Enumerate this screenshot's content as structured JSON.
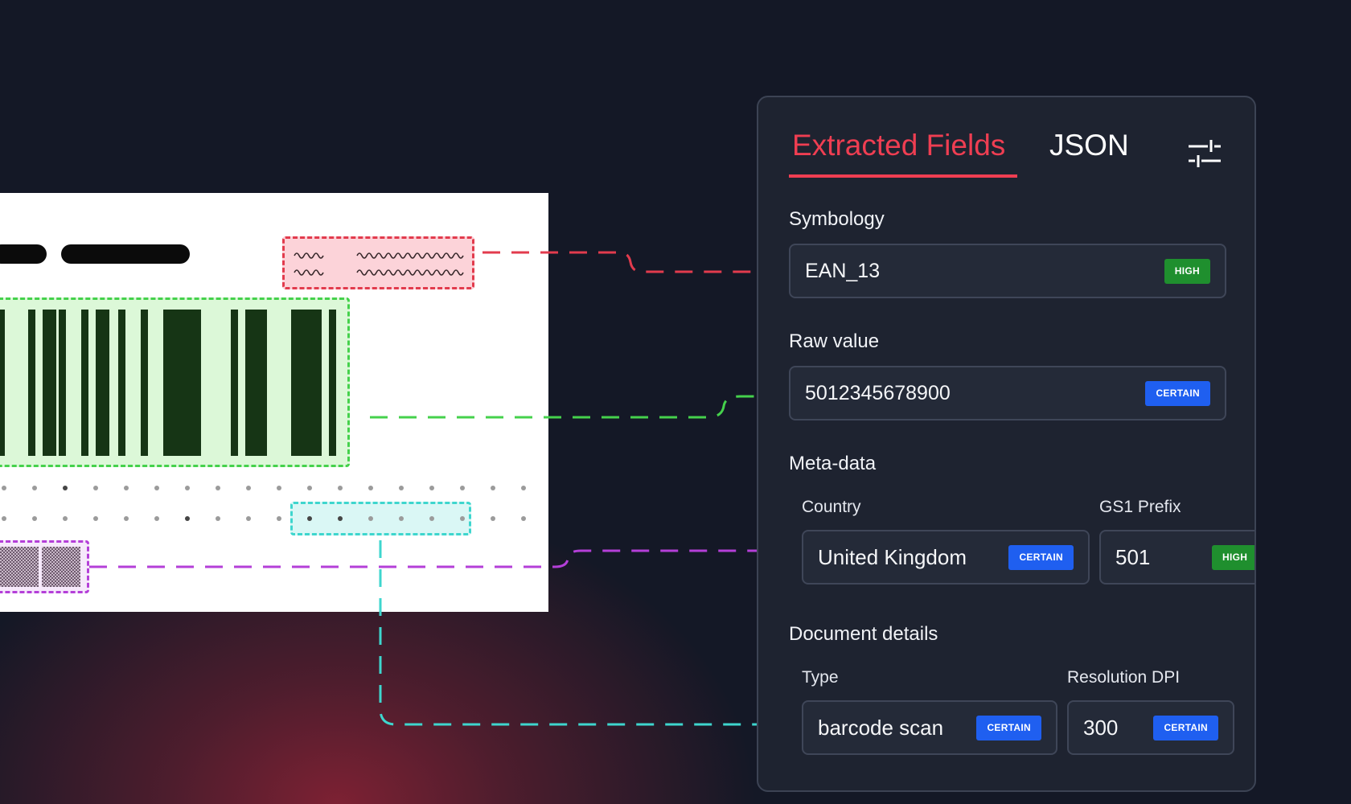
{
  "tabs": {
    "fields": "Extracted Fields",
    "json": "JSON"
  },
  "symbology": {
    "label": "Symbology",
    "value": "EAN_13",
    "confidence": "HIGH"
  },
  "raw_value": {
    "label": "Raw value",
    "value": "5012345678900",
    "confidence": "CERTAIN"
  },
  "meta": {
    "heading": "Meta-data",
    "country": {
      "label": "Country",
      "value": "United Kingdom",
      "confidence": "CERTAIN"
    },
    "gs1": {
      "label": "GS1 Prefix",
      "value": "501",
      "confidence": "HIGH"
    }
  },
  "document": {
    "heading": "Document details",
    "type": {
      "label": "Type",
      "value": "barcode scan",
      "confidence": "CERTAIN"
    },
    "dpi": {
      "label": "Resolution DPI",
      "value": "300",
      "confidence": "CERTAIN"
    }
  },
  "colors": {
    "accent": "#ef3e52",
    "high_badge": "#1f8f2e",
    "certain_badge": "#1f5ff0",
    "handwriting_link": "#e23b4d",
    "barcode_link": "#45d14c",
    "image_link": "#b43fd8",
    "dots_link": "#3ed6ce"
  },
  "icons": {
    "settings": "sliders-icon"
  }
}
